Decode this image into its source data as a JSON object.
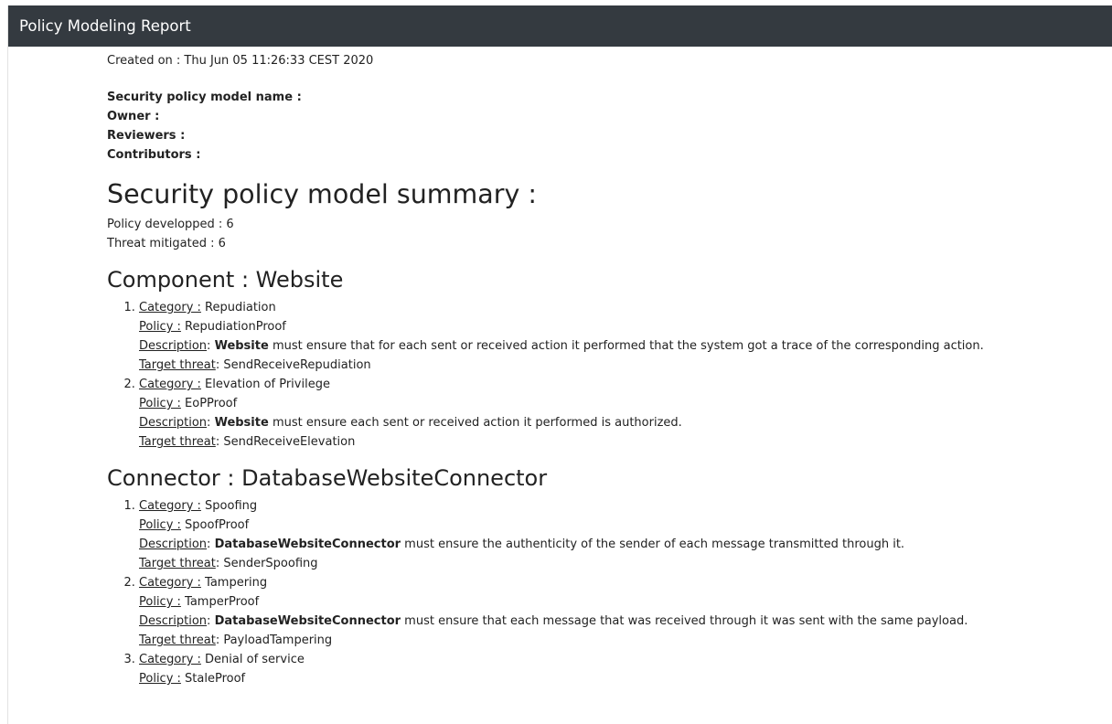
{
  "header": {
    "title": "Policy Modeling Report"
  },
  "created": "Created on : Thu Jun 05 11:26:33 CEST 2020",
  "meta": {
    "model_name_label": "Security policy model name :",
    "owner_label": "Owner :",
    "reviewers_label": "Reviewers :",
    "contributors_label": "Contributors :"
  },
  "summary": {
    "title": "Security policy model summary :",
    "policy_developped": "Policy developped : 6",
    "threat_mitigated": "Threat mitigated : 6"
  },
  "labels": {
    "category": "Category :",
    "policy": "Policy :",
    "description": "Description",
    "target_threat": "Target threat"
  },
  "sections": [
    {
      "title": "Component : Website",
      "items": [
        {
          "category": "Repudiation",
          "policy": "RepudiationProof",
          "subject": "Website",
          "description": "must ensure that for each sent or received action it performed that the system got a trace of the corresponding action.",
          "threat": "SendReceiveRepudiation"
        },
        {
          "category": "Elevation of Privilege",
          "policy": "EoPProof",
          "subject": "Website",
          "description": "must ensure each sent or received action it performed is authorized.",
          "threat": "SendReceiveElevation"
        }
      ]
    },
    {
      "title": "Connector : DatabaseWebsiteConnector",
      "items": [
        {
          "category": "Spoofing",
          "policy": "SpoofProof",
          "subject": "DatabaseWebsiteConnector",
          "description": "must ensure the authenticity of the sender of each message transmitted through it.",
          "threat": "SenderSpoofing"
        },
        {
          "category": "Tampering",
          "policy": "TamperProof",
          "subject": "DatabaseWebsiteConnector",
          "description": "must ensure that each message that was received through it was sent with the same payload.",
          "threat": "PayloadTampering"
        },
        {
          "category": "Denial of service",
          "policy": "StaleProof",
          "subject": "",
          "description": "",
          "threat": ""
        }
      ]
    }
  ]
}
